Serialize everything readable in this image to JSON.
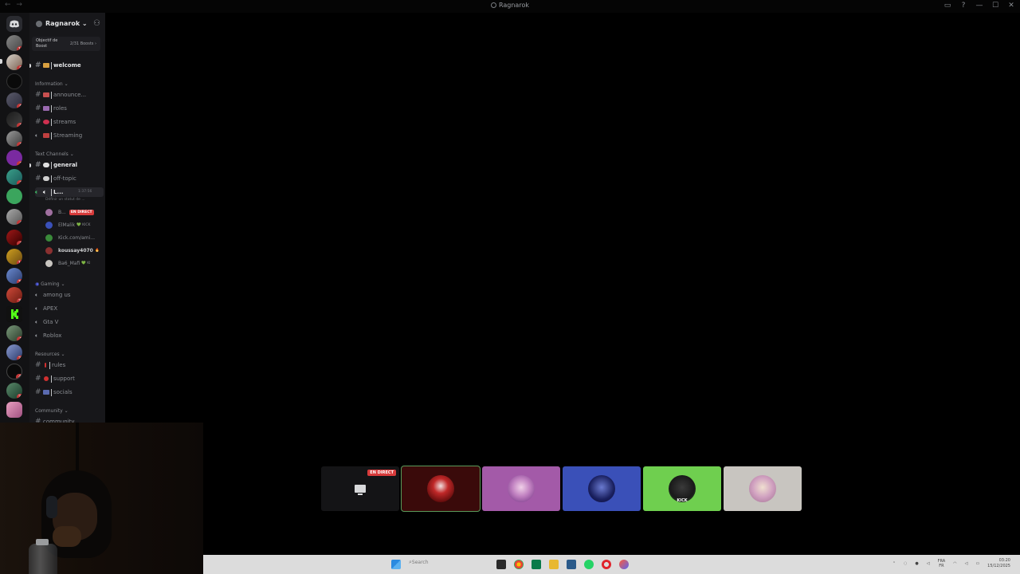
{
  "window": {
    "title": "Ragnarok",
    "nav_arrows": "← →",
    "controls": {
      "screen": "▭",
      "help": "?",
      "minimize": "—",
      "maximize": "☐",
      "close": "✕"
    }
  },
  "server_rail": {
    "servers": [
      {
        "name": "discord-home-icon",
        "badge": ""
      },
      {
        "name": "server-1",
        "badge": "12"
      },
      {
        "name": "server-2",
        "badge": "9"
      },
      {
        "name": "server-3",
        "badge": ""
      },
      {
        "name": "server-4",
        "badge": "6"
      },
      {
        "name": "server-5",
        "badge": "1"
      },
      {
        "name": "server-6",
        "badge": "1"
      },
      {
        "name": "server-7",
        "badge": "3"
      },
      {
        "name": "server-8",
        "badge": "2"
      },
      {
        "name": "server-9",
        "badge": ""
      },
      {
        "name": "server-10",
        "badge": "4"
      },
      {
        "name": "server-11",
        "badge": "3"
      },
      {
        "name": "server-12",
        "badge": "14"
      },
      {
        "name": "server-13",
        "badge": "31"
      },
      {
        "name": "server-14",
        "badge": "24"
      },
      {
        "name": "server-15-kick",
        "badge": ""
      },
      {
        "name": "server-16",
        "badge": "1"
      },
      {
        "name": "server-17",
        "badge": "22"
      },
      {
        "name": "server-18",
        "badge": "4"
      },
      {
        "name": "server-19",
        "badge": "26"
      },
      {
        "name": "server-20",
        "badge": ""
      }
    ]
  },
  "sidebar": {
    "server_name": "Ragnarok ⌄",
    "boost": {
      "label": "Objectif de Boost",
      "progress": "2/31 Boosts ›"
    },
    "channels_top": [
      {
        "name": "welcome",
        "emoji": "👋"
      }
    ],
    "categories": [
      {
        "label": "Information ⌄"
      },
      {
        "label": "Text Channels ⌄"
      },
      {
        "label": "Gaming ⌄"
      },
      {
        "label": "Resources ⌄"
      },
      {
        "label": "Community ⌄"
      }
    ],
    "information": [
      "announce...",
      "roles",
      "streams",
      "Streaming"
    ],
    "text_channels": [
      "general",
      "off-topic"
    ],
    "voice_active": {
      "name": "L...",
      "time": "1:37:56",
      "status": "Définir un statut de ..."
    },
    "voice_users": [
      {
        "name": "B...",
        "live": "EN DIRECT"
      },
      {
        "name": "ElMalik",
        "suffix": "💚 KICK"
      },
      {
        "name": "Kick.com/ami..."
      },
      {
        "name": "koussay4070",
        "suffix": "🔥"
      },
      {
        "name": "Ba6_Mafi",
        "suffix": "💚 KI"
      }
    ],
    "gaming": [
      "among us",
      "APEX",
      "Gta V",
      "Roblox"
    ],
    "resources": [
      "rules",
      "support",
      "socials"
    ],
    "community_partial": "community"
  },
  "stream_tiles": [
    {
      "type": "screen",
      "live": "EN DIRECT"
    },
    {
      "type": "avatar",
      "color": "#7a1e1e"
    },
    {
      "type": "avatar",
      "color": "#a35aa8"
    },
    {
      "type": "avatar",
      "color": "#3a50b8"
    },
    {
      "type": "avatar",
      "color": "#6fcf4f",
      "label": "KICK"
    },
    {
      "type": "avatar",
      "color": "#c8c5c0"
    }
  ],
  "taskbar": {
    "search_placeholder": "Search",
    "lang": "FRA\nFR",
    "time": "03:20",
    "date": "15/12/2025"
  }
}
